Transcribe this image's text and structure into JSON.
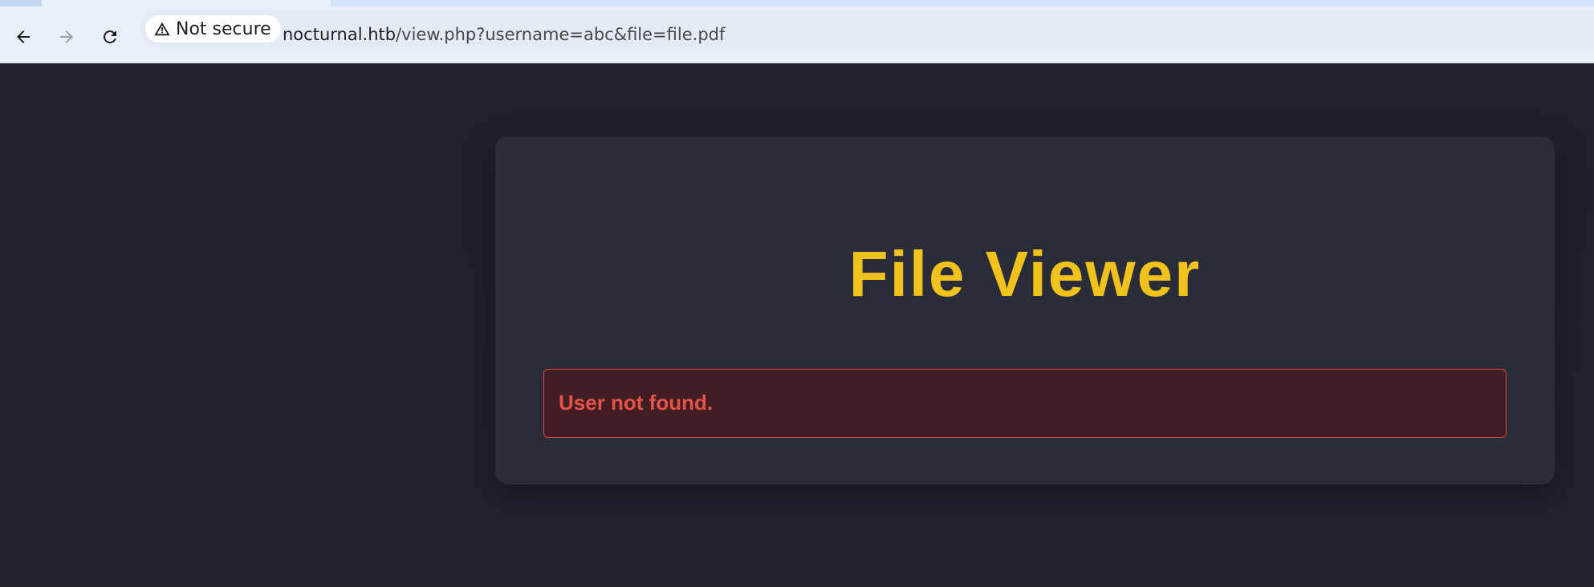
{
  "browser": {
    "security_chip": {
      "icon": "warning-triangle-icon",
      "label": "Not secure"
    },
    "url": {
      "host": "nocturnal.htb",
      "path": "/view.php?username=abc&file=file.pdf"
    },
    "nav": {
      "back_icon": "arrow-left-icon",
      "forward_icon": "arrow-right-icon",
      "reload_icon": "reload-icon"
    }
  },
  "page": {
    "title": "File Viewer",
    "error_message": "User not found."
  },
  "colors": {
    "background": "#1f232d",
    "card": "#2a2c38",
    "title": "#f1c21b",
    "error_text": "#e55246",
    "error_border": "#d9453b",
    "error_bg": "#401e24"
  }
}
